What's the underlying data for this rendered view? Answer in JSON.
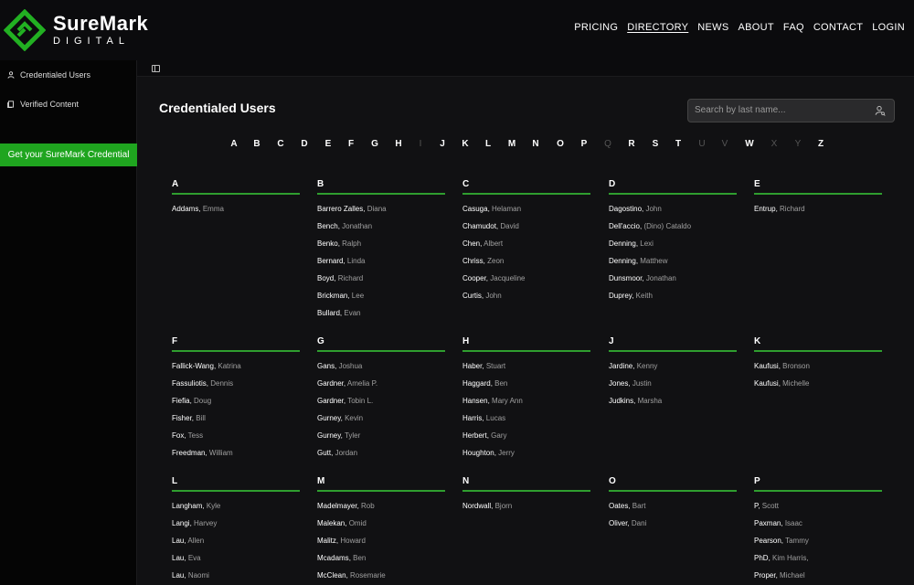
{
  "brand": {
    "name": "SureMark",
    "sub": "DIGITAL"
  },
  "nav": [
    {
      "label": "PRICING",
      "active": false
    },
    {
      "label": "DIRECTORY",
      "active": true
    },
    {
      "label": "NEWS",
      "active": false
    },
    {
      "label": "ABOUT",
      "active": false
    },
    {
      "label": "FAQ",
      "active": false
    },
    {
      "label": "CONTACT",
      "active": false
    },
    {
      "label": "LOGIN",
      "active": false
    }
  ],
  "sidebar": {
    "items": [
      {
        "label": "Credentialed Users",
        "icon": "user-icon"
      },
      {
        "label": "Verified Content",
        "icon": "document-icon"
      }
    ],
    "cta": "Get your SureMark Credential"
  },
  "main": {
    "title": "Credentialed Users",
    "search": {
      "placeholder": "Search by last name...",
      "value": ""
    }
  },
  "alphabet": [
    {
      "letter": "A",
      "enabled": true
    },
    {
      "letter": "B",
      "enabled": true
    },
    {
      "letter": "C",
      "enabled": true
    },
    {
      "letter": "D",
      "enabled": true
    },
    {
      "letter": "E",
      "enabled": true
    },
    {
      "letter": "F",
      "enabled": true
    },
    {
      "letter": "G",
      "enabled": true
    },
    {
      "letter": "H",
      "enabled": true
    },
    {
      "letter": "I",
      "enabled": false
    },
    {
      "letter": "J",
      "enabled": true
    },
    {
      "letter": "K",
      "enabled": true
    },
    {
      "letter": "L",
      "enabled": true
    },
    {
      "letter": "M",
      "enabled": true
    },
    {
      "letter": "N",
      "enabled": true
    },
    {
      "letter": "O",
      "enabled": true
    },
    {
      "letter": "P",
      "enabled": true
    },
    {
      "letter": "Q",
      "enabled": false
    },
    {
      "letter": "R",
      "enabled": true
    },
    {
      "letter": "S",
      "enabled": true
    },
    {
      "letter": "T",
      "enabled": true
    },
    {
      "letter": "U",
      "enabled": false
    },
    {
      "letter": "V",
      "enabled": false
    },
    {
      "letter": "W",
      "enabled": true
    },
    {
      "letter": "X",
      "enabled": false
    },
    {
      "letter": "Y",
      "enabled": false
    },
    {
      "letter": "Z",
      "enabled": true
    }
  ],
  "sections": [
    {
      "letter": "A",
      "entries": [
        [
          "Addams",
          "Emma"
        ]
      ]
    },
    {
      "letter": "B",
      "entries": [
        [
          "Barrero Zalles",
          "Diana"
        ],
        [
          "Bench",
          "Jonathan"
        ],
        [
          "Benko",
          "Ralph"
        ],
        [
          "Bernard",
          "Linda"
        ],
        [
          "Boyd",
          "Richard"
        ],
        [
          "Brickman",
          " Lee"
        ],
        [
          "Bullard",
          "Evan"
        ]
      ]
    },
    {
      "letter": "C",
      "entries": [
        [
          "Casuga",
          "Helaman"
        ],
        [
          "Chamudot",
          "David"
        ],
        [
          "Chen",
          "Albert"
        ],
        [
          "Chriss",
          "Zeon"
        ],
        [
          "Cooper",
          "Jacqueline"
        ],
        [
          "Curtis",
          "John"
        ]
      ]
    },
    {
      "letter": "D",
      "entries": [
        [
          "Dagostino",
          "John"
        ],
        [
          "Dell'accio",
          "(Dino) Cataldo"
        ],
        [
          "Denning",
          "Lexi"
        ],
        [
          "Denning",
          "Matthew"
        ],
        [
          "Dunsmoor",
          "Jonathan"
        ],
        [
          "Duprey",
          "Keith"
        ]
      ]
    },
    {
      "letter": "E",
      "entries": [
        [
          "Entrup",
          "Richard"
        ]
      ]
    },
    {
      "letter": "F",
      "entries": [
        [
          "Fallick-Wang",
          "Katrina"
        ],
        [
          "Fassuliotis",
          "Dennis"
        ],
        [
          "Fiefia",
          "Doug"
        ],
        [
          "Fisher",
          "Bill"
        ],
        [
          "Fox",
          "Tess"
        ],
        [
          "Freedman",
          "William"
        ]
      ]
    },
    {
      "letter": "G",
      "entries": [
        [
          "Gans",
          "Joshua"
        ],
        [
          "Gardner",
          "Amelia P."
        ],
        [
          "Gardner",
          "Tobin L."
        ],
        [
          "Gurney",
          "Kevin"
        ],
        [
          "Gurney",
          "Tyler"
        ],
        [
          "Gutt",
          "Jordan"
        ]
      ]
    },
    {
      "letter": "H",
      "entries": [
        [
          "Haber",
          "Stuart"
        ],
        [
          "Haggard",
          "Ben"
        ],
        [
          "Hansen",
          "Mary Ann"
        ],
        [
          "Harris",
          "Lucas"
        ],
        [
          "Herbert",
          "Gary"
        ],
        [
          "Houghton",
          "Jerry"
        ]
      ]
    },
    {
      "letter": "J",
      "entries": [
        [
          "Jardine",
          "Kenny"
        ],
        [
          "Jones",
          "Justin"
        ],
        [
          "Judkins",
          "Marsha"
        ]
      ]
    },
    {
      "letter": "K",
      "entries": [
        [
          "Kaufusi",
          "Bronson"
        ],
        [
          "Kaufusi",
          "Michelle"
        ]
      ]
    },
    {
      "letter": "L",
      "entries": [
        [
          "Langham",
          "Kyle"
        ],
        [
          "Langi",
          "Harvey"
        ],
        [
          "Lau",
          "Allen"
        ],
        [
          "Lau",
          "Eva"
        ],
        [
          "Lau",
          "Naomi"
        ]
      ]
    },
    {
      "letter": "M",
      "entries": [
        [
          "Madelmayer",
          "Rob"
        ],
        [
          "Malekan",
          "Omid"
        ],
        [
          "Malitz",
          "Howard"
        ],
        [
          "Mcadams",
          "Ben"
        ],
        [
          "McClean",
          "Rosemarie"
        ]
      ]
    },
    {
      "letter": "N",
      "entries": [
        [
          "Nordwall",
          "Bjorn"
        ]
      ]
    },
    {
      "letter": "O",
      "entries": [
        [
          "Oates",
          "Bart"
        ],
        [
          "Oliver",
          "Dani"
        ]
      ]
    },
    {
      "letter": "P",
      "entries": [
        [
          "P",
          "Scott"
        ],
        [
          "Paxman",
          "Isaac"
        ],
        [
          "Pearson",
          "Tammy"
        ],
        [
          "PhD",
          "Kim Harris,"
        ],
        [
          "Proper",
          "Michael"
        ]
      ]
    }
  ],
  "colors": {
    "accent": "#1fa51f",
    "rule": "#2f9e2f",
    "background": "#111113"
  }
}
